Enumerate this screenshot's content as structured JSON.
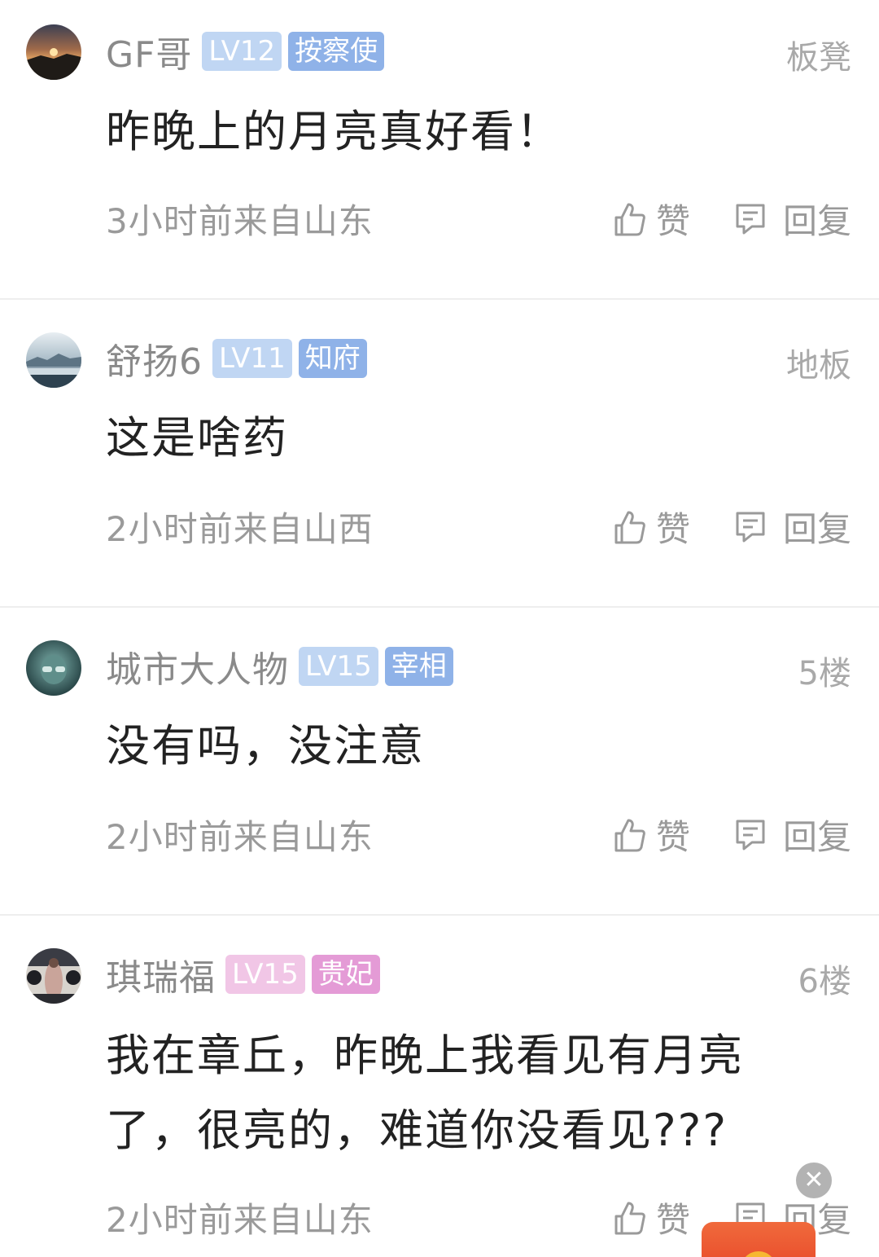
{
  "comments": [
    {
      "username": "GF哥",
      "level": "LV12",
      "title": "按察使",
      "floor": "板凳",
      "text": "昨晚上的月亮真好看！",
      "meta": "3小时前来自山东",
      "like_label": "赞",
      "reply_label": "回复",
      "badge_colors": {
        "level": "#c0d6f3",
        "title": "#8fb2e8"
      }
    },
    {
      "username": "舒扬6",
      "level": "LV11",
      "title": "知府",
      "floor": "地板",
      "text": "这是啥药",
      "meta": "2小时前来自山西",
      "like_label": "赞",
      "reply_label": "回复",
      "badge_colors": {
        "level": "#c0d6f3",
        "title": "#8fb2e8"
      }
    },
    {
      "username": "城市大人物",
      "level": "LV15",
      "title": "宰相",
      "floor": "5楼",
      "text": "没有吗，没注意",
      "meta": "2小时前来自山东",
      "like_label": "赞",
      "reply_label": "回复",
      "badge_colors": {
        "level": "#c0d6f3",
        "title": "#8fb2e8"
      }
    },
    {
      "username": "琪瑞福",
      "level": "LV15",
      "title": "贵妃",
      "floor": "6楼",
      "text": "我在章丘，昨晚上我看见有月亮了，很亮的，难道你没看见???",
      "meta": "2小时前来自山东",
      "like_label": "赞",
      "reply_label": "回复",
      "badge_colors": {
        "level": "#f1c6e6",
        "title": "#e49bd6"
      }
    }
  ],
  "icons": {
    "like": "thumbs-up-icon",
    "reply": "comment-icon",
    "close": "close-icon"
  },
  "close_glyph": "✕"
}
